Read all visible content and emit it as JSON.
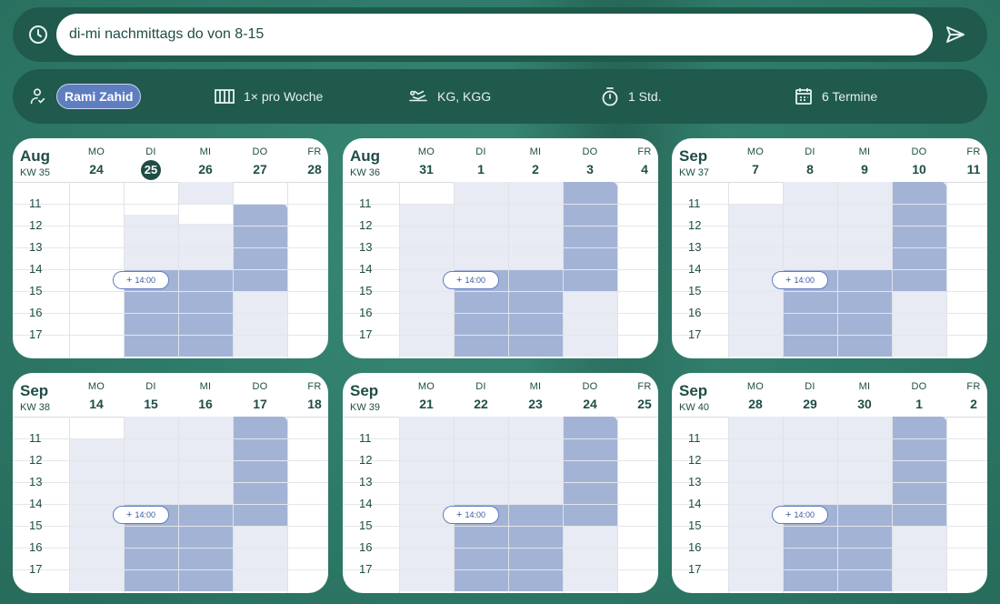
{
  "search": {
    "value": "di-mi nachmittags do von 8-15"
  },
  "info": {
    "therapist": "Rami Zahid",
    "frequency": "1× pro Woche",
    "treatment": "KG, KGG",
    "duration": "1 Std.",
    "appointments": "6 Termine"
  },
  "hours": [
    "11",
    "12",
    "13",
    "14",
    "15",
    "16",
    "17"
  ],
  "slot_label": "14:00",
  "weeks": [
    {
      "month": "Aug",
      "kw": "KW 35",
      "days": [
        {
          "name": "MO",
          "num": "24"
        },
        {
          "name": "DI",
          "num": "25",
          "today": true
        },
        {
          "name": "MI",
          "num": "26"
        },
        {
          "name": "DO",
          "num": "27"
        },
        {
          "name": "FR",
          "num": "28"
        }
      ]
    },
    {
      "month": "Aug",
      "kw": "KW 36",
      "days": [
        {
          "name": "MO",
          "num": "31"
        },
        {
          "name": "DI",
          "num": "1"
        },
        {
          "name": "MI",
          "num": "2"
        },
        {
          "name": "DO",
          "num": "3"
        },
        {
          "name": "FR",
          "num": "4"
        }
      ]
    },
    {
      "month": "Sep",
      "kw": "KW 37",
      "days": [
        {
          "name": "MO",
          "num": "7"
        },
        {
          "name": "DI",
          "num": "8"
        },
        {
          "name": "MI",
          "num": "9"
        },
        {
          "name": "DO",
          "num": "10"
        },
        {
          "name": "FR",
          "num": "11"
        }
      ]
    },
    {
      "month": "Sep",
      "kw": "KW 38",
      "days": [
        {
          "name": "MO",
          "num": "14"
        },
        {
          "name": "DI",
          "num": "15"
        },
        {
          "name": "MI",
          "num": "16"
        },
        {
          "name": "DO",
          "num": "17"
        },
        {
          "name": "FR",
          "num": "18"
        }
      ]
    },
    {
      "month": "Sep",
      "kw": "KW 39",
      "days": [
        {
          "name": "MO",
          "num": "21"
        },
        {
          "name": "DI",
          "num": "22"
        },
        {
          "name": "MI",
          "num": "23"
        },
        {
          "name": "DO",
          "num": "24"
        },
        {
          "name": "FR",
          "num": "25"
        }
      ]
    },
    {
      "month": "Sep",
      "kw": "KW 40",
      "days": [
        {
          "name": "MO",
          "num": "28"
        },
        {
          "name": "DI",
          "num": "29"
        },
        {
          "name": "MI",
          "num": "30"
        },
        {
          "name": "DO",
          "num": "1"
        },
        {
          "name": "FR",
          "num": "2"
        }
      ]
    }
  ],
  "colors": {
    "accent": "#5f7ec0",
    "available": "#a3b3d6",
    "busy": "#e8ebf3",
    "dark": "#1f4d46"
  }
}
